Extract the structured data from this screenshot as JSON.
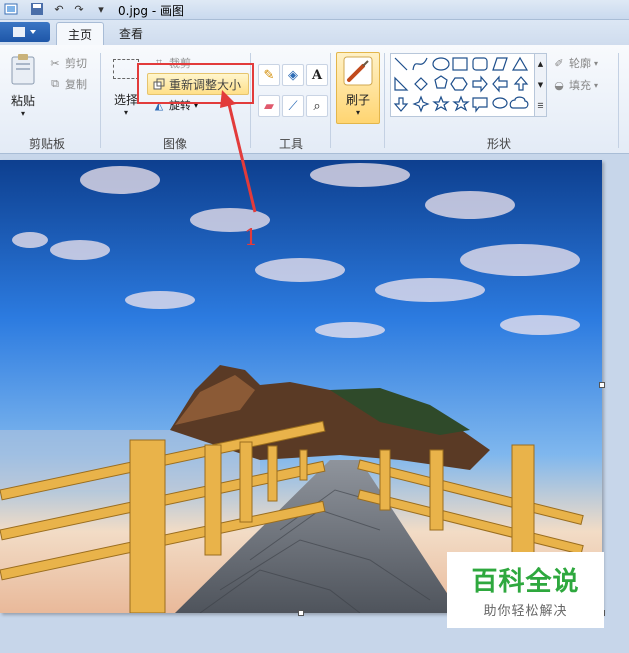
{
  "window": {
    "title": "0.jpg - 画图"
  },
  "tabs": [
    {
      "label": "主页",
      "active": true
    },
    {
      "label": "查看",
      "active": false
    }
  ],
  "clipboard": {
    "paste_label": "粘贴",
    "cut_label": "剪切",
    "copy_label": "复制",
    "group_label": "剪贴板"
  },
  "image": {
    "select_label": "选择",
    "crop_label": "裁剪",
    "resize_label": "重新调整大小",
    "rotate_label": "旋转",
    "group_label": "图像"
  },
  "tools": {
    "group_label": "工具",
    "text_tool": "A"
  },
  "brushes": {
    "label": "刷子"
  },
  "shapes": {
    "group_label": "形状",
    "outline_label": "轮廓",
    "fill_label": "填充"
  },
  "annotation": {
    "step_number": "1",
    "color": "#e23b3b"
  },
  "watermark": {
    "main": "百科全说",
    "sub": "助你轻松解决"
  },
  "colors": {
    "accent": "#1e56a8",
    "highlight": "#ffd86b",
    "watermark_green": "#2ea83e"
  }
}
